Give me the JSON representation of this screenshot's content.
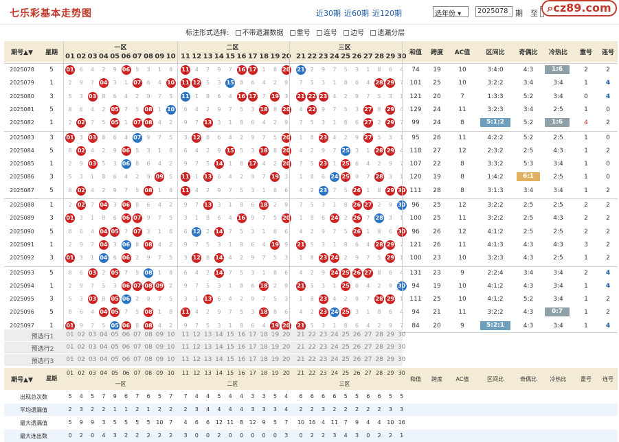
{
  "header": {
    "title": "七乐彩基本走势图",
    "period_links": [
      "近30期",
      "近60期",
      "近120期"
    ],
    "year_select": "选年份",
    "from_period": "2025078",
    "to_label": "期",
    "to_label2": "至",
    "to_period": "2025097",
    "logo": "cz89.com"
  },
  "options": {
    "label": "标注形式选择:",
    "items": [
      "不带遗漏数据",
      "重号",
      "连号",
      "边号",
      "遗漏分层"
    ]
  },
  "columns": {
    "period": "期号",
    "week": "星期",
    "zone1": "一区",
    "zone2": "二区",
    "zone3": "三区",
    "sum": "和值",
    "span": "跨度",
    "ac": "AC值",
    "zone_ratio": "区间比",
    "odd_even": "奇偶比",
    "hot_cold": "冷热比",
    "repeat": "重号",
    "consec": "连号"
  },
  "rows": [
    {
      "p": "2025078",
      "w": "5",
      "nums": [
        1,
        6,
        11,
        16,
        17,
        20
      ],
      "blue": [
        21
      ],
      "sum": "74",
      "span": "19",
      "ac": "10",
      "zr": "3:4:0",
      "oe": "4:3",
      "hc": "1:6",
      "rep": "2",
      "con": "2",
      "hcHl": "gray"
    },
    {
      "p": "2025079",
      "w": "1",
      "nums": [
        4,
        7,
        10,
        11,
        12,
        28,
        29
      ],
      "blue": [
        15
      ],
      "sum": "101",
      "span": "25",
      "ac": "10",
      "zr": "3:2:2",
      "oe": "3:4",
      "hc": "3:4",
      "rep": "1",
      "con": "4"
    },
    {
      "p": "2025080",
      "w": "3",
      "nums": [
        3,
        16,
        17,
        19,
        21,
        22,
        23
      ],
      "blue": [
        11
      ],
      "sum": "121",
      "span": "20",
      "ac": "7",
      "zr": "1:3:3",
      "oe": "5:2",
      "hc": "3:4",
      "rep": "0",
      "con": "4"
    },
    {
      "p": "2025081",
      "w": "5",
      "nums": [
        5,
        8,
        18,
        20,
        22,
        27,
        29
      ],
      "blue": [
        10
      ],
      "sum": "129",
      "span": "24",
      "ac": "11",
      "zr": "3:2:3",
      "oe": "3:4",
      "hc": "2:5",
      "rep": "1",
      "con": "0"
    },
    {
      "p": "2025082",
      "w": "1",
      "nums": [
        2,
        5,
        7,
        8,
        13,
        27,
        29
      ],
      "blue": [
        2
      ],
      "sum": "99",
      "span": "24",
      "ac": "8",
      "zr": "5:1:2",
      "oe": "5:2",
      "hc": "1:6",
      "rep": "4",
      "con": "2",
      "zrHl": "blue",
      "hcHl": "gray"
    },
    {
      "p": "2025083",
      "w": "3",
      "nums": [
        1,
        3,
        12,
        20,
        23,
        27
      ],
      "blue": [
        7
      ],
      "sum": "95",
      "span": "26",
      "ac": "11",
      "zr": "4:2:2",
      "oe": "5:2",
      "hc": "2:5",
      "rep": "1",
      "con": "0"
    },
    {
      "p": "2025084",
      "w": "5",
      "nums": [
        2,
        6,
        15,
        18,
        20,
        28,
        29
      ],
      "blue": [
        25
      ],
      "sum": "118",
      "span": "27",
      "ac": "12",
      "zr": "2:3:2",
      "oe": "2:5",
      "hc": "4:3",
      "rep": "1",
      "con": "2"
    },
    {
      "p": "2025085",
      "w": "1",
      "nums": [
        3,
        14,
        17,
        20,
        23,
        25
      ],
      "blue": [
        6
      ],
      "sum": "107",
      "span": "22",
      "ac": "8",
      "zr": "3:3:2",
      "oe": "5:3",
      "hc": "3:4",
      "rep": "1",
      "con": "0"
    },
    {
      "p": "2025086",
      "w": "3",
      "nums": [
        9,
        11,
        13,
        19,
        28,
        25
      ],
      "blue": [
        24
      ],
      "sum": "120",
      "span": "19",
      "ac": "8",
      "zr": "1:4:2",
      "oe": "6:1",
      "hc": "2:5",
      "rep": "1",
      "con": "0",
      "oeHl": "gold"
    },
    {
      "p": "2025087",
      "w": "5",
      "nums": [
        2,
        8,
        11,
        26,
        29,
        30
      ],
      "blue": [
        23
      ],
      "sum": "111",
      "span": "28",
      "ac": "8",
      "zr": "3:1:3",
      "oe": "3:4",
      "hc": "3:4",
      "rep": "1",
      "con": "2"
    },
    {
      "p": "2025088",
      "w": "1",
      "nums": [
        2,
        4,
        6,
        13,
        18,
        26,
        27
      ],
      "blue": [
        30
      ],
      "sum": "96",
      "span": "25",
      "ac": "12",
      "zr": "3:2:2",
      "oe": "2:5",
      "hc": "2:5",
      "rep": "2",
      "con": "2"
    },
    {
      "p": "2025089",
      "w": "3",
      "nums": [
        1,
        6,
        7,
        16,
        20,
        24,
        26
      ],
      "blue": [
        28
      ],
      "sum": "100",
      "span": "25",
      "ac": "11",
      "zr": "3:2:2",
      "oe": "2:5",
      "hc": "4:3",
      "rep": "2",
      "con": "2"
    },
    {
      "p": "2025090",
      "w": "5",
      "nums": [
        4,
        5,
        7,
        14,
        26,
        30
      ],
      "blue": [
        12
      ],
      "sum": "96",
      "span": "26",
      "ac": "12",
      "zr": "4:1:2",
      "oe": "2:5",
      "hc": "2:5",
      "rep": "2",
      "con": "2"
    },
    {
      "p": "2025091",
      "w": "1",
      "nums": [
        4,
        8,
        19,
        21,
        28,
        29
      ],
      "blue": [
        6
      ],
      "sum": "121",
      "span": "26",
      "ac": "11",
      "zr": "4:1:3",
      "oe": "4:3",
      "hc": "4:3",
      "rep": "3",
      "con": "2"
    },
    {
      "p": "2025092",
      "w": "3",
      "nums": [
        1,
        6,
        12,
        14,
        23,
        24,
        29
      ],
      "blue": [
        4
      ],
      "sum": "100",
      "span": "23",
      "ac": "10",
      "zr": "3:2:3",
      "oe": "4:3",
      "hc": "2:5",
      "rep": "1",
      "con": "2"
    },
    {
      "p": "2025093",
      "w": "5",
      "nums": [
        3,
        5,
        14,
        24,
        25,
        26,
        27
      ],
      "blue": [
        8
      ],
      "sum": "131",
      "span": "23",
      "ac": "9",
      "zr": "2:2:4",
      "oe": "3:4",
      "hc": "3:4",
      "rep": "2",
      "con": "4"
    },
    {
      "p": "2025094",
      "w": "1",
      "nums": [
        6,
        7,
        8,
        9,
        18,
        21,
        25
      ],
      "blue": [
        30
      ],
      "sum": "94",
      "span": "19",
      "ac": "10",
      "zr": "4:1:2",
      "oe": "4:3",
      "hc": "3:4",
      "rep": "1",
      "con": "4"
    },
    {
      "p": "2025095",
      "w": "3",
      "nums": [
        3,
        13,
        23,
        28,
        29,
        5
      ],
      "blue": [
        6
      ],
      "sum": "111",
      "span": "25",
      "ac": "10",
      "zr": "4:1:2",
      "oe": "5:2",
      "hc": "3:4",
      "rep": "1",
      "con": "2"
    },
    {
      "p": "2025096",
      "w": "5",
      "nums": [
        4,
        5,
        8,
        11,
        18,
        23,
        25
      ],
      "blue": [
        24
      ],
      "sum": "94",
      "span": "21",
      "ac": "11",
      "zr": "3:2:2",
      "oe": "4:3",
      "hc": "0:7",
      "rep": "1",
      "con": "2",
      "hcHl": "gray"
    },
    {
      "p": "2025097",
      "w": "1",
      "nums": [
        1,
        6,
        8,
        19,
        20,
        21
      ],
      "blue": [
        5
      ],
      "sum": "84",
      "span": "20",
      "ac": "9",
      "zr": "5:2:1",
      "oe": "4:3",
      "hc": "3:4",
      "rep": "1",
      "con": "4",
      "zrHl": "blue"
    }
  ],
  "preselect": [
    "预选行1",
    "预选行2",
    "预选行3"
  ],
  "stats": {
    "labels": [
      "出现总次数",
      "平均遗漏值",
      "最大遗漏值",
      "最大连出数"
    ],
    "rows": [
      [
        "5",
        "4",
        "5",
        "7",
        "9",
        "6",
        "7",
        "6",
        "5",
        "7",
        "7",
        "4",
        "4",
        "5",
        "4",
        "4",
        "3",
        "3",
        "5",
        "4",
        "6",
        "6",
        "6",
        "6",
        "5",
        "5",
        "6",
        "6",
        "5",
        "5"
      ],
      [
        "2",
        "3",
        "2",
        "2",
        "1",
        "1",
        "2",
        "1",
        "2",
        "2",
        "2",
        "3",
        "4",
        "4",
        "4",
        "4",
        "3",
        "3",
        "3",
        "4",
        "2",
        "2",
        "3",
        "2",
        "2",
        "2",
        "2",
        "2",
        "3",
        "3"
      ],
      [
        "5",
        "9",
        "9",
        "3",
        "5",
        "5",
        "5",
        "5",
        "10",
        "7",
        "4",
        "6",
        "6",
        "12",
        "11",
        "8",
        "12",
        "9",
        "5",
        "7",
        "10",
        "16",
        "4",
        "11",
        "7",
        "9",
        "4",
        "4",
        "10",
        "16"
      ],
      [
        "0",
        "2",
        "0",
        "4",
        "3",
        "2",
        "2",
        "2",
        "2",
        "2",
        "3",
        "0",
        "0",
        "2",
        "0",
        "0",
        "0",
        "0",
        "0",
        "3",
        "0",
        "2",
        "2",
        "3",
        "4",
        "3",
        "0",
        "2",
        "2",
        "1"
      ]
    ]
  }
}
